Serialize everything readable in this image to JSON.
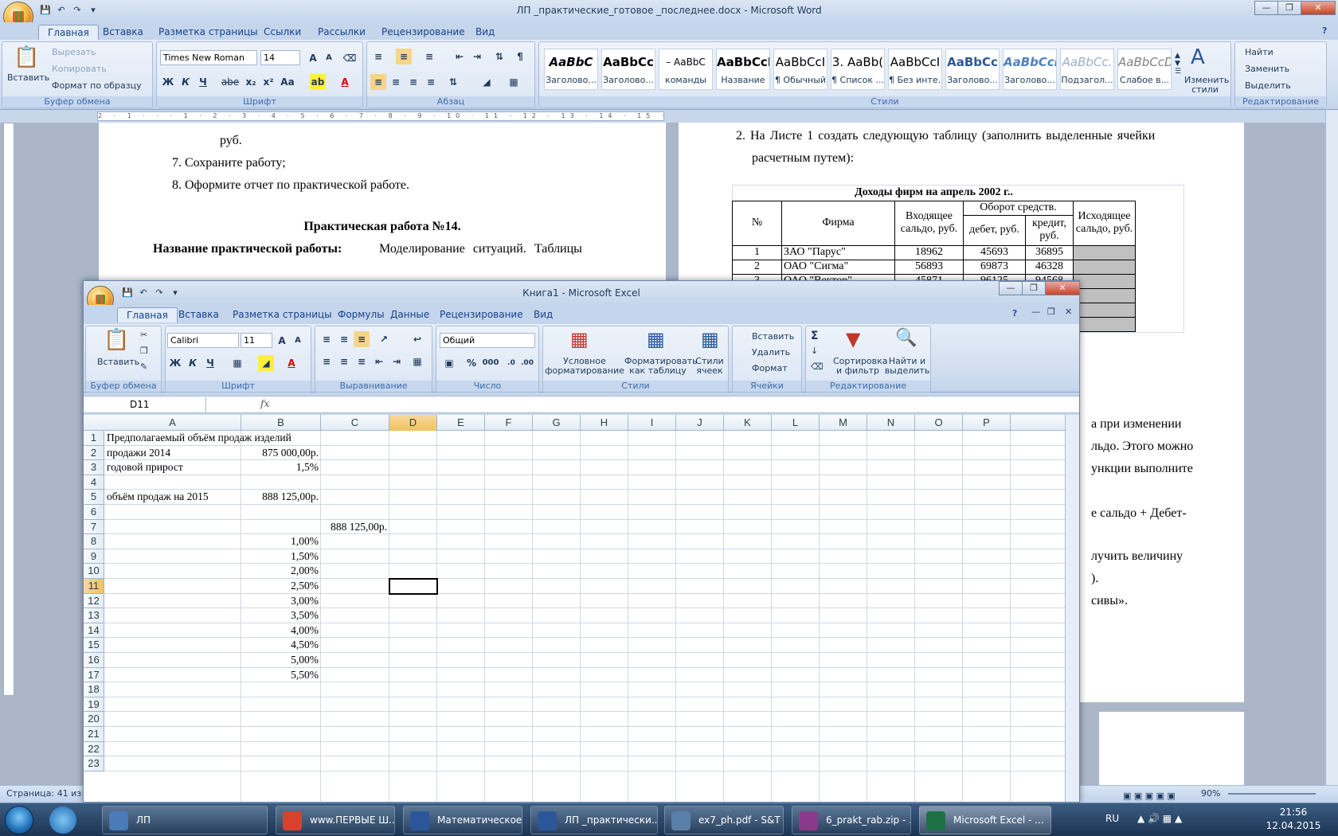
{
  "word": {
    "title": "ЛП _практические_готовое _последнее.docx - Microsoft Word",
    "tabs": [
      "Главная",
      "Вставка",
      "Разметка страницы",
      "Ссылки",
      "Рассылки",
      "Рецензирование",
      "Вид"
    ],
    "clipboard": {
      "paste": "Вставить",
      "cut": "Вырезать",
      "copy": "Копировать",
      "format_painter": "Формат по образцу",
      "group": "Буфер обмена"
    },
    "font": {
      "name": "Times New Roman",
      "size": "14",
      "group": "Шрифт",
      "buttons": [
        "Ж",
        "К",
        "Ч",
        "abe",
        "x₂",
        "x²",
        "Aa"
      ]
    },
    "paragraph": {
      "group": "Абзац"
    },
    "styles": {
      "group": "Стили",
      "items": [
        {
          "sample": "AaBbC",
          "label": "Заголово..."
        },
        {
          "sample": "AaBbCc",
          "label": "Заголово..."
        },
        {
          "sample": "– AaBbC",
          "label": "команды"
        },
        {
          "sample": "AaBbCcI",
          "label": "Название"
        },
        {
          "sample": "AaBbCcI",
          "label": "¶ Обычный"
        },
        {
          "sample": "3. AaBb(",
          "label": "¶ Список ..."
        },
        {
          "sample": "AaBbCcI",
          "label": "¶ Без инте..."
        },
        {
          "sample": "AaBbCc",
          "label": "Заголово..."
        },
        {
          "sample": "AaBbCcI",
          "label": "Заголово..."
        },
        {
          "sample": "AaBbCc.",
          "label": "Подзагол..."
        },
        {
          "sample": "AaBbCcD",
          "label": "Слабое в..."
        }
      ],
      "change": "Изменить стили"
    },
    "editing": {
      "group": "Редактирование",
      "find": "Найти",
      "replace": "Заменить",
      "select": "Выделить"
    },
    "ruler_text": "2 · 1 · · · 1 · 2 · 3 · 4 · 5 · 6 · 7 · 8 · 9 · 10 · 11 · 12 · 13 · 14 · 15 · 16 · · 18",
    "left_page": {
      "line_rub": "руб.",
      "item7": "7.  Сохраните работу;",
      "item8": "8.  Оформите отчет по практической работе.",
      "heading": "Практическая работа №14.",
      "name_bold": "Название практической работы:",
      "name_rest": "Моделирование ситуаций.   Таблицы"
    },
    "right_page": {
      "item2_a": "2.  На Листе 1 создать следующую таблицу (заполнить выделенные ячейки",
      "item2_b": "расчетным путем):",
      "table_title": "Доходы фирм на апрель 2002 г..",
      "hdr_no": "№",
      "hdr_firm": "Фирма",
      "hdr_in": "Входящее сальдо, руб.",
      "hdr_turnover": "Оборот средств.",
      "hdr_debit": "дебет, руб.",
      "hdr_credit": "кредит, руб.",
      "hdr_out": "Исходящее сальдо, руб.",
      "rows": [
        {
          "n": "1",
          "firm": "ЗАО \"Парус\"",
          "in": "18962",
          "debit": "45693",
          "credit": "36895"
        },
        {
          "n": "2",
          "firm": "ОАО \"Сигма\"",
          "in": "56893",
          "debit": "69873",
          "credit": "46328"
        },
        {
          "n": "3",
          "firm": "ОАО \"Вектор\"",
          "in": "45871",
          "debit": "96125",
          "credit": "94568"
        }
      ],
      "frag1": "а при изменении",
      "frag2": "льдо. Этого можно",
      "frag3": "ункции выполните",
      "frag4": "е сальдо + Дебет-",
      "frag5": "лучить величину",
      "frag6": ").",
      "frag7": "сивы»."
    },
    "status": "Страница: 41 из 6",
    "zoom": "90%"
  },
  "excel": {
    "title": "Книга1 - Microsoft Excel",
    "tabs": [
      "Главная",
      "Вставка",
      "Разметка страницы",
      "Формулы",
      "Данные",
      "Рецензирование",
      "Вид"
    ],
    "clipboard": {
      "paste": "Вставить",
      "group": "Буфер обмена"
    },
    "font": {
      "name": "Calibri",
      "size": "11",
      "group": "Шрифт",
      "buttons": [
        "Ж",
        "К",
        "Ч"
      ]
    },
    "alignment": {
      "group": "Выравнивание"
    },
    "number": {
      "format": "Общий",
      "group": "Число",
      "percent": "%",
      "thousands": "000"
    },
    "styles": {
      "group": "Стили",
      "conditional": "Условное форматирование",
      "as_table": "Форматировать как таблицу",
      "cell_styles": "Стили ячеек"
    },
    "cells": {
      "group": "Ячейки",
      "insert": "Вставить",
      "delete": "Удалить",
      "format": "Формат"
    },
    "editing": {
      "group": "Редактирование",
      "sort": "Сортировка и фильтр",
      "find": "Найти и выделить"
    },
    "name_box": "D11",
    "fx": "fx",
    "columns": [
      "A",
      "B",
      "C",
      "D",
      "E",
      "F",
      "G",
      "H",
      "I",
      "J",
      "K",
      "L",
      "M",
      "N",
      "O",
      "P"
    ],
    "rows": [
      "1",
      "2",
      "3",
      "4",
      "5",
      "6",
      "7",
      "8",
      "9",
      "10",
      "11",
      "12",
      "13",
      "14",
      "15",
      "16",
      "17",
      "18",
      "19",
      "20",
      "21",
      "22",
      "23"
    ],
    "cells_data": {
      "A1": "Предполагаемый объём продаж изделий",
      "A2": "продажи 2014",
      "B2": "875 000,00р.",
      "A3": "годовой прирост",
      "B3": "1,5%",
      "A5": "объём продаж на 2015",
      "B5": "888 125,00р.",
      "C7": "888 125,00р.",
      "B8": "1,00%",
      "B9": "1,50%",
      "B10": "2,00%",
      "B11": "2,50%",
      "B12": "3,00%",
      "B13": "3,50%",
      "B14": "4,00%",
      "B15": "4,50%",
      "B16": "5,00%",
      "B17": "5,50%"
    }
  },
  "taskbar": {
    "items": [
      {
        "label": "ЛП",
        "color": "#4a7ab8"
      },
      {
        "label": "www.ПЕРВЫЕ Ш...",
        "color": "#d8412f"
      },
      {
        "label": "Математическое...",
        "color": "#2b579a"
      },
      {
        "label": "ЛП _практически...",
        "color": "#2b579a"
      },
      {
        "label": "ex7_ph.pdf - S&T ...",
        "color": "#5a7fa8"
      },
      {
        "label": "6_prakt_rab.zip - ...",
        "color": "#8b3a8b"
      },
      {
        "label": "Microsoft Excel - ...",
        "color": "#1e7145"
      }
    ],
    "lang": "RU",
    "time": "21:56",
    "date": "12.04.2015"
  }
}
